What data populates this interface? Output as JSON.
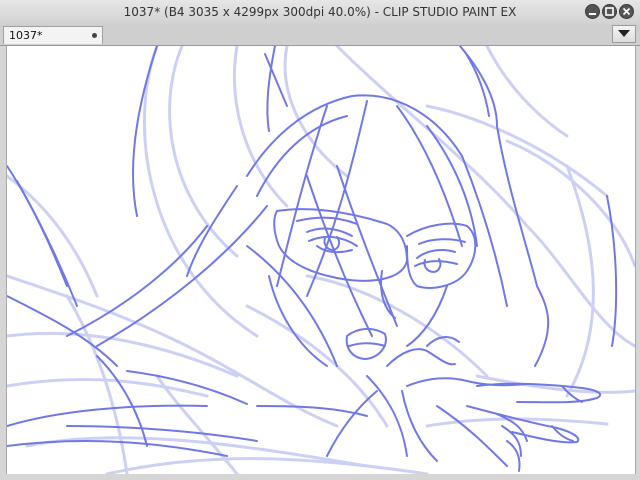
{
  "window": {
    "title": "1037* (B4 3035 x 4299px 300dpi 40.0%)  - CLIP STUDIO PAINT EX"
  },
  "tabs": [
    {
      "label": "1037*",
      "modified_marker": "•"
    }
  ],
  "canvas": {
    "document": "1037*",
    "zoom": "40.0%",
    "content": "sketch-drawing"
  },
  "colors": {
    "sketch_stroke": "#7078e8",
    "sketch_light": "#c8ccf4",
    "paper": "#ffffff"
  },
  "icons": {
    "minimize": "minimize-icon",
    "restore": "restore-icon",
    "close": "close-icon",
    "tab_menu": "chevron-down-icon"
  }
}
